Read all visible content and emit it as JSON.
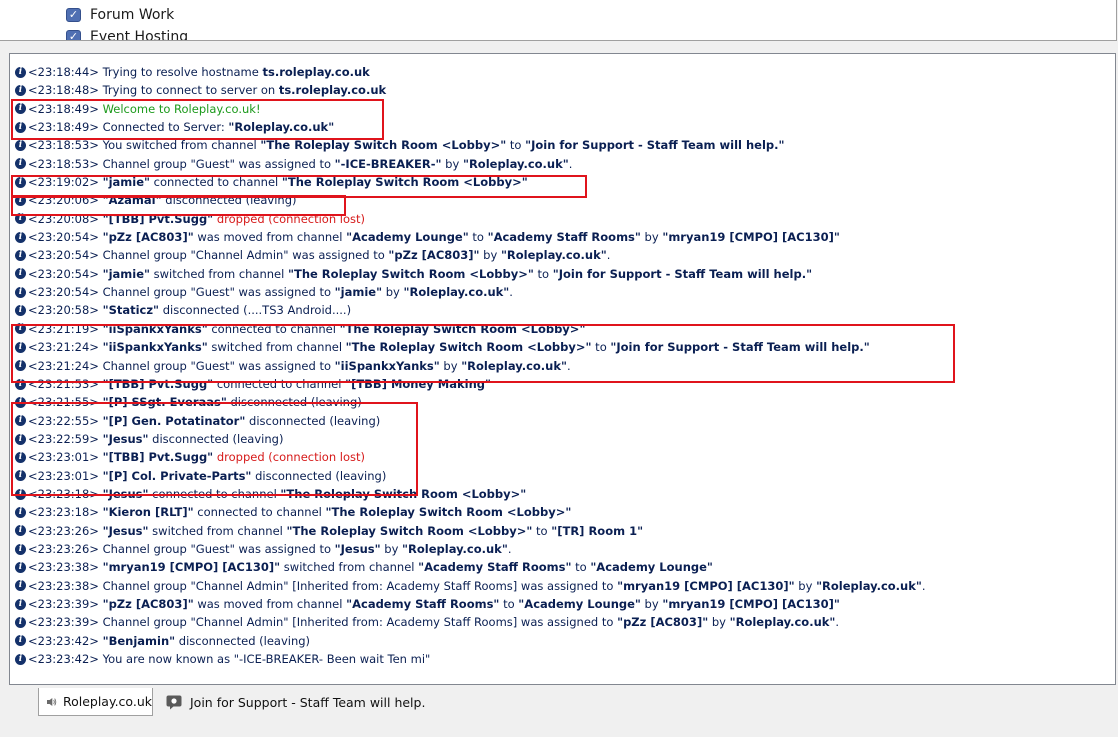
{
  "tree": {
    "items": [
      {
        "label": "Forum Work"
      },
      {
        "label": "Event Hosting"
      }
    ]
  },
  "colors": {
    "text": "#0a1f52",
    "welcome": "#1c9a1c",
    "dropped": "#d61a1a",
    "highlight": "#e0141c"
  },
  "log": [
    [
      {
        "t": "<23:18:44> Trying to resolve hostname "
      },
      {
        "t": "ts.roleplay.co.uk",
        "s": "b"
      }
    ],
    [
      {
        "t": "<23:18:48> Trying to connect to server on "
      },
      {
        "t": "ts.roleplay.co.uk",
        "s": "b"
      }
    ],
    [
      {
        "t": "<23:18:49> "
      },
      {
        "t": "Welcome to Roleplay.co.uk!",
        "s": "green"
      }
    ],
    [
      {
        "t": "<23:18:49> Connected to Server: "
      },
      {
        "t": "\"Roleplay.co.uk\"",
        "s": "b"
      }
    ],
    [
      {
        "t": "<23:18:53> You switched from channel "
      },
      {
        "t": "\"The Roleplay Switch Room <Lobby>\"",
        "s": "b"
      },
      {
        "t": " to "
      },
      {
        "t": "\"Join for Support - Staff Team will help.\"",
        "s": "b"
      }
    ],
    [
      {
        "t": "<23:18:53> Channel group \"Guest\" was assigned to "
      },
      {
        "t": "\"-ICE-BREAKER-\"",
        "s": "b"
      },
      {
        "t": " by "
      },
      {
        "t": "\"Roleplay.co.uk\"",
        "s": "b"
      },
      {
        "t": "."
      }
    ],
    [
      {
        "t": "<23:19:02> "
      },
      {
        "t": "\"jamie\"",
        "s": "b"
      },
      {
        "t": " connected to channel "
      },
      {
        "t": "\"The Roleplay Switch Room <Lobby>\"",
        "s": "b"
      }
    ],
    [
      {
        "t": "<23:20:06> "
      },
      {
        "t": "\"Azamai\"",
        "s": "b"
      },
      {
        "t": " disconnected (leaving)"
      }
    ],
    [
      {
        "t": "<23:20:08> "
      },
      {
        "t": "\"[TBB] Pvt.Sugg\"",
        "s": "b"
      },
      {
        "t": " dropped (connection lost)",
        "s": "red"
      }
    ],
    [
      {
        "t": "<23:20:54> "
      },
      {
        "t": "\"pZz [AC803]\"",
        "s": "b"
      },
      {
        "t": " was moved from channel "
      },
      {
        "t": "\"Academy Lounge\"",
        "s": "b"
      },
      {
        "t": " to "
      },
      {
        "t": "\"Academy Staff Rooms\"",
        "s": "b"
      },
      {
        "t": " by "
      },
      {
        "t": "\"mryan19 [CMPO] [AC130]\"",
        "s": "b"
      }
    ],
    [
      {
        "t": "<23:20:54> Channel group \"Channel Admin\" was assigned to "
      },
      {
        "t": "\"pZz [AC803]\"",
        "s": "b"
      },
      {
        "t": " by "
      },
      {
        "t": "\"Roleplay.co.uk\"",
        "s": "b"
      },
      {
        "t": "."
      }
    ],
    [
      {
        "t": "<23:20:54> "
      },
      {
        "t": "\"jamie\"",
        "s": "b"
      },
      {
        "t": " switched from channel "
      },
      {
        "t": "\"The Roleplay Switch Room <Lobby>\"",
        "s": "b"
      },
      {
        "t": " to "
      },
      {
        "t": "\"Join for Support - Staff Team will help.\"",
        "s": "b"
      }
    ],
    [
      {
        "t": "<23:20:54> Channel group \"Guest\" was assigned to "
      },
      {
        "t": "\"jamie\"",
        "s": "b"
      },
      {
        "t": " by "
      },
      {
        "t": "\"Roleplay.co.uk\"",
        "s": "b"
      },
      {
        "t": "."
      }
    ],
    [
      {
        "t": "<23:20:58> "
      },
      {
        "t": "\"Staticz\"",
        "s": "b"
      },
      {
        "t": " disconnected (....TS3 Android....)"
      }
    ],
    [
      {
        "t": "<23:21:19> "
      },
      {
        "t": "\"iiSpankxYanks\"",
        "s": "b"
      },
      {
        "t": " connected to channel "
      },
      {
        "t": "\"The Roleplay Switch Room <Lobby>\"",
        "s": "b"
      }
    ],
    [
      {
        "t": "<23:21:24> "
      },
      {
        "t": "\"iiSpankxYanks\"",
        "s": "b"
      },
      {
        "t": " switched from channel "
      },
      {
        "t": "\"The Roleplay Switch Room <Lobby>\"",
        "s": "b"
      },
      {
        "t": " to "
      },
      {
        "t": "\"Join for Support - Staff Team will help.\"",
        "s": "b"
      }
    ],
    [
      {
        "t": "<23:21:24> Channel group \"Guest\" was assigned to "
      },
      {
        "t": "\"iiSpankxYanks\"",
        "s": "b"
      },
      {
        "t": " by "
      },
      {
        "t": "\"Roleplay.co.uk\"",
        "s": "b"
      },
      {
        "t": "."
      }
    ],
    [
      {
        "t": "<23:21:53> "
      },
      {
        "t": "\"[TBB] Pvt.Sugg\"",
        "s": "b"
      },
      {
        "t": " connected to channel "
      },
      {
        "t": "\"[TBB] Money Making\"",
        "s": "b"
      }
    ],
    [
      {
        "t": "<23:21:55> "
      },
      {
        "t": "\"[P] SSgt. Everaas\"",
        "s": "b"
      },
      {
        "t": " disconnected (leaving)"
      }
    ],
    [
      {
        "t": "<23:22:55> "
      },
      {
        "t": "\"[P] Gen. Potatinator\"",
        "s": "b"
      },
      {
        "t": " disconnected (leaving)"
      }
    ],
    [
      {
        "t": "<23:22:59> "
      },
      {
        "t": "\"Jesus\"",
        "s": "b"
      },
      {
        "t": " disconnected (leaving)"
      }
    ],
    [
      {
        "t": "<23:23:01> "
      },
      {
        "t": "\"[TBB] Pvt.Sugg\"",
        "s": "b"
      },
      {
        "t": " dropped (connection lost)",
        "s": "red"
      }
    ],
    [
      {
        "t": "<23:23:01> "
      },
      {
        "t": "\"[P] Col. Private-Parts\"",
        "s": "b"
      },
      {
        "t": " disconnected (leaving)"
      }
    ],
    [
      {
        "t": "<23:23:18> "
      },
      {
        "t": "\"Jesus\"",
        "s": "b"
      },
      {
        "t": " connected to channel "
      },
      {
        "t": "\"The Roleplay Switch Room <Lobby>\"",
        "s": "b"
      }
    ],
    [
      {
        "t": "<23:23:18> "
      },
      {
        "t": "\"Kieron [RLT]\"",
        "s": "b"
      },
      {
        "t": " connected to channel "
      },
      {
        "t": "\"The Roleplay Switch Room <Lobby>\"",
        "s": "b"
      }
    ],
    [
      {
        "t": "<23:23:26> "
      },
      {
        "t": "\"Jesus\"",
        "s": "b"
      },
      {
        "t": " switched from channel "
      },
      {
        "t": "\"The Roleplay Switch Room <Lobby>\"",
        "s": "b"
      },
      {
        "t": " to "
      },
      {
        "t": "\"[TR] Room 1\"",
        "s": "b"
      }
    ],
    [
      {
        "t": "<23:23:26> Channel group \"Guest\" was assigned to "
      },
      {
        "t": "\"Jesus\"",
        "s": "b"
      },
      {
        "t": " by "
      },
      {
        "t": "\"Roleplay.co.uk\"",
        "s": "b"
      },
      {
        "t": "."
      }
    ],
    [
      {
        "t": "<23:23:38> "
      },
      {
        "t": "\"mryan19 [CMPO] [AC130]\"",
        "s": "b"
      },
      {
        "t": " switched from channel "
      },
      {
        "t": "\"Academy Staff Rooms\"",
        "s": "b"
      },
      {
        "t": " to "
      },
      {
        "t": "\"Academy Lounge\"",
        "s": "b"
      }
    ],
    [
      {
        "t": "<23:23:38> Channel group \"Channel Admin\" [Inherited from: Academy Staff Rooms] was assigned to "
      },
      {
        "t": "\"mryan19 [CMPO] [AC130]\"",
        "s": "b"
      },
      {
        "t": " by "
      },
      {
        "t": "\"Roleplay.co.uk\"",
        "s": "b"
      },
      {
        "t": "."
      }
    ],
    [
      {
        "t": "<23:23:39> "
      },
      {
        "t": "\"pZz [AC803]\"",
        "s": "b"
      },
      {
        "t": " was moved from channel "
      },
      {
        "t": "\"Academy Staff Rooms\"",
        "s": "b"
      },
      {
        "t": " to "
      },
      {
        "t": "\"Academy Lounge\"",
        "s": "b"
      },
      {
        "t": " by "
      },
      {
        "t": "\"mryan19 [CMPO] [AC130]\"",
        "s": "b"
      }
    ],
    [
      {
        "t": "<23:23:39> Channel group \"Channel Admin\" [Inherited from: Academy Staff Rooms] was assigned to "
      },
      {
        "t": "\"pZz [AC803]\"",
        "s": "b"
      },
      {
        "t": " by "
      },
      {
        "t": "\"Roleplay.co.uk\"",
        "s": "b"
      },
      {
        "t": "."
      }
    ],
    [
      {
        "t": "<23:23:42> "
      },
      {
        "t": "\"Benjamin\"",
        "s": "b"
      },
      {
        "t": " disconnected (leaving)"
      }
    ],
    [
      {
        "t": "<23:23:42> You are now known as \"-ICE-BREAKER- Been wait Ten mi\""
      }
    ]
  ],
  "tabs": [
    {
      "label": "Roleplay.co.uk",
      "icon": "server-speaker-icon",
      "active": true
    },
    {
      "label": "Join for Support - Staff Team will help.",
      "icon": "channel-chat-icon",
      "active": false
    }
  ]
}
